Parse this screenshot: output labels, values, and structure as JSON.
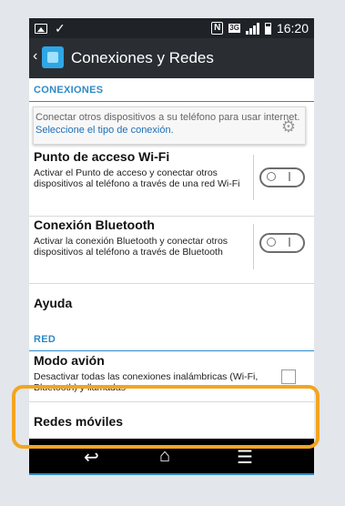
{
  "status_bar": {
    "network_type": "3G",
    "time": "16:20"
  },
  "action_bar": {
    "title": "Conexiones y Redes"
  },
  "sections": {
    "conexiones": "CONEXIONES",
    "red": "RED"
  },
  "hint": {
    "text": "Conectar otros dispositivos a su teléfono para usar internet.",
    "link": "Seleccione el tipo de conexión."
  },
  "items": {
    "hotspot": {
      "title": "Punto de acceso Wi-Fi",
      "desc": "Activar el Punto de acceso y conectar otros dispositivos al teléfono a través de una red Wi-Fi"
    },
    "bluetooth": {
      "title": "Conexión Bluetooth",
      "desc": "Activar la conexión Bluetooth y conectar otros dispositivos al teléfono a través de Bluetooth"
    },
    "help": {
      "title": "Ayuda"
    },
    "airplane": {
      "title": "Modo avión",
      "desc": "Desactivar todas las conexiones inalámbricas (Wi-Fi, Bluetooth) y llamadas"
    },
    "mobile": {
      "title": "Redes móviles"
    }
  },
  "colors": {
    "accent": "#2d8ac7",
    "highlight": "#f2a520",
    "status_bar": "#1f2227",
    "action_bar": "#2a2e33"
  }
}
